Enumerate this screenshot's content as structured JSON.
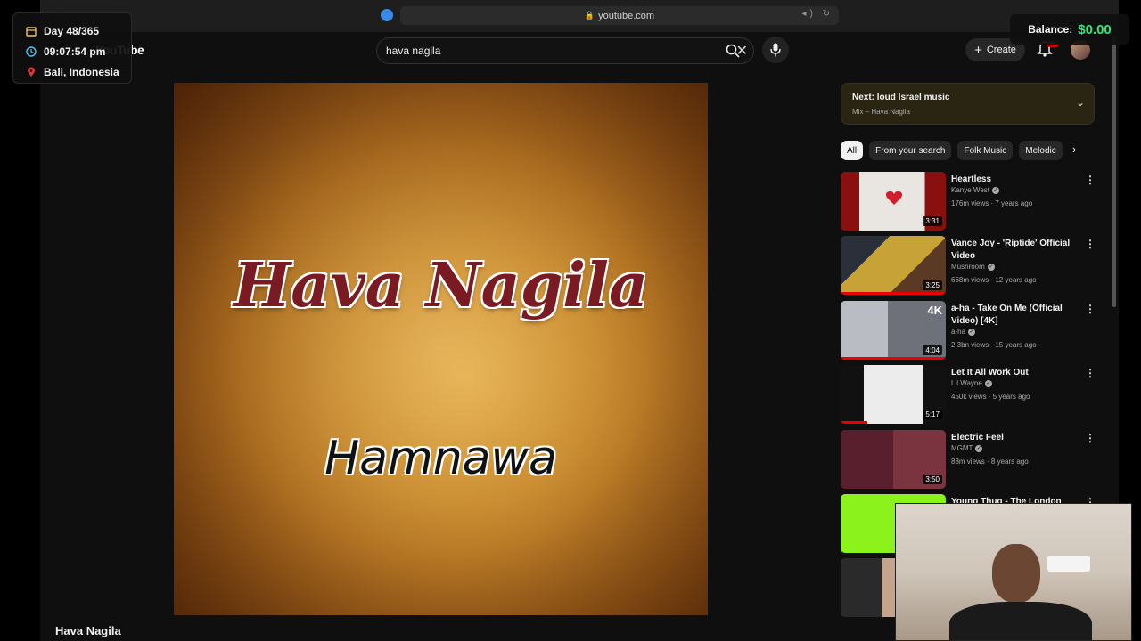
{
  "browser": {
    "url": "youtube.com"
  },
  "overlay": {
    "day": "Day 48/365",
    "time": "09:07:54 pm",
    "location": "Bali, Indonesia",
    "balance_label": "Balance:",
    "balance_value": "$0.00"
  },
  "header": {
    "logo": "YouTube",
    "search_value": "hava nagila",
    "create_label": "Create",
    "notif_count": "9+"
  },
  "video": {
    "art_title": "Hava Nagila",
    "art_subtitle": "Hamnawa",
    "title": "Hava Nagila"
  },
  "up_next": {
    "title": "Next: loud Israel music",
    "subtitle": "Mix – Hava Nagila"
  },
  "chips": [
    "All",
    "From your search",
    "Folk Music",
    "Melodic"
  ],
  "recommendations": [
    {
      "title": "Heartless",
      "channel": "Kanye West",
      "meta": "176m views · 7 years ago",
      "duration": "3:31"
    },
    {
      "title": "Vance Joy - 'Riptide' Official Video",
      "channel": "Mushroom",
      "meta": "668m views · 12 years ago",
      "duration": "3:25"
    },
    {
      "title": "a-ha - Take On Me (Official Video) [4K]",
      "channel": "a-ha",
      "meta": "2.3bn views · 15 years ago",
      "duration": "4:04"
    },
    {
      "title": "Let It All Work Out",
      "channel": "Lil Wayne",
      "meta": "450k views · 5 years ago",
      "duration": "5:17"
    },
    {
      "title": "Electric Feel",
      "channel": "MGMT",
      "meta": "88m views · 8 years ago",
      "duration": "3:50"
    },
    {
      "title": "Young Thug - The London (ft. J...",
      "channel": "",
      "meta": "",
      "duration": ""
    }
  ],
  "colors": {
    "accent": "#ff0000",
    "balance": "#2ee87a",
    "next_bg": "#2a2413"
  }
}
